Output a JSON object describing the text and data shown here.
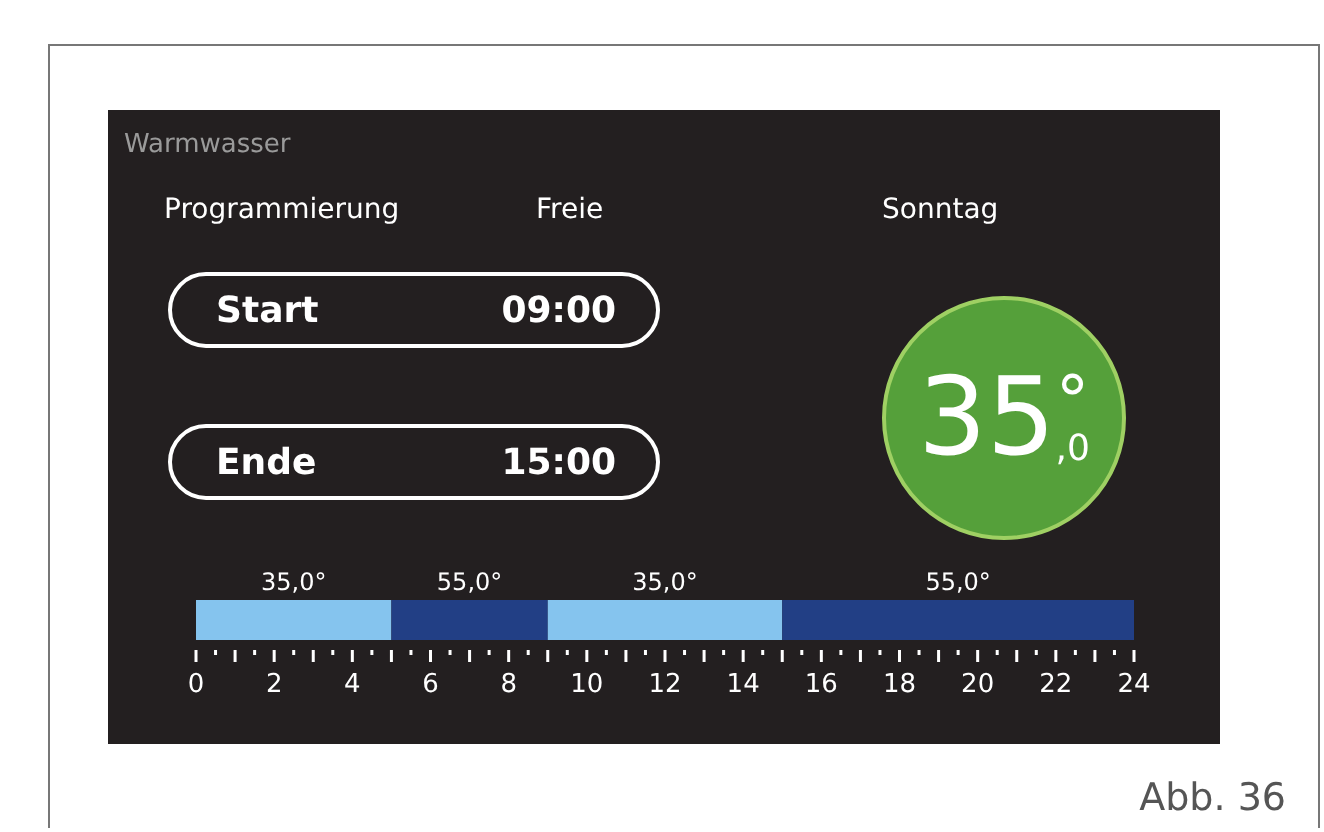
{
  "screen": {
    "title": "Warmwasser",
    "mode_label": "Programmierung",
    "mode_value": "Freie",
    "day": "Sonntag",
    "times": [
      {
        "label": "Start",
        "value": "09:00"
      },
      {
        "label": "Ende",
        "value": "15:00"
      }
    ],
    "temperature": {
      "value": "35",
      "unit": "°",
      "decimal": ",0"
    },
    "chart_data": {
      "type": "bar",
      "orientation": "horizontal",
      "stacked": true,
      "xlim": [
        0,
        24
      ],
      "xticks": [
        0,
        2,
        4,
        6,
        8,
        10,
        12,
        14,
        16,
        18,
        20,
        22,
        24
      ],
      "series": [
        {
          "name": "35,0°",
          "color": "#85c4ee",
          "values": [
            5
          ]
        },
        {
          "name": "55,0°",
          "color": "#223f85",
          "values": [
            4
          ]
        },
        {
          "name": "35,0°",
          "color": "#85c4ee",
          "values": [
            6
          ]
        },
        {
          "name": "55,0°",
          "color": "#223f85",
          "values": [
            9
          ]
        }
      ]
    }
  },
  "caption": "Abb. 36"
}
